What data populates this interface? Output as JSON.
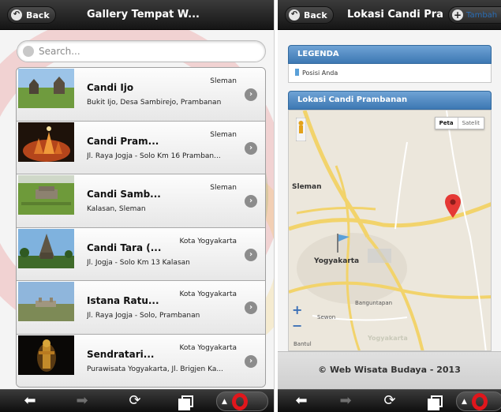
{
  "left_screen": {
    "header": {
      "back_label": "Back",
      "title": "Gallery Tempat W..."
    },
    "search": {
      "placeholder": "Search..."
    },
    "items": [
      {
        "title": "Candi Ijo",
        "region": "Sleman",
        "address": "Bukit Ijo, Desa Sambirejo, Prambanan"
      },
      {
        "title": "Candi Pram...",
        "region": "Sleman",
        "address": "Jl. Raya Jogja - Solo Km 16 Pramban..."
      },
      {
        "title": "Candi Samb...",
        "region": "Sleman",
        "address": "Kalasan, Sleman"
      },
      {
        "title": "Candi Tara (...",
        "region": "Kota Yogyakarta",
        "address": "Jl. Jogja - Solo Km 13 Kalasan"
      },
      {
        "title": "Istana Ratu...",
        "region": "Kota Yogyakarta",
        "address": "Jl. Raya Jogja - Solo, Prambanan"
      },
      {
        "title": "Sendratari...",
        "region": "Kota Yogyakarta",
        "address": "Purawisata Yogyakarta, Jl. Brigjen Ka..."
      }
    ]
  },
  "right_screen": {
    "header": {
      "back_label": "Back",
      "title": "Lokasi Candi Pra...",
      "add_label": "Tambah"
    },
    "legend": {
      "title": "LEGENDA",
      "item": "Posisi Anda"
    },
    "location_header": "Lokasi Candi Prambanan",
    "map": {
      "type_options": [
        "Peta",
        "Satelit"
      ],
      "selected_type": "Peta",
      "places": {
        "sleman": "Sleman",
        "yogyakarta": "Yogyakarta",
        "bantul": "Bantul",
        "banguntapan": "Banguntapan",
        "sewon": "Sewon",
        "yogyakarta_faded": "Yogyakarta"
      },
      "zoom_in": "+",
      "zoom_out": "−"
    },
    "footer": "© Web Wisata Budaya - 2013"
  },
  "colors": {
    "header": "#1e1e1e",
    "legend_bar": "#4f88c4",
    "opera_red": "#e0161c",
    "map_road": "#f2d36b",
    "pin": "#e53935"
  }
}
